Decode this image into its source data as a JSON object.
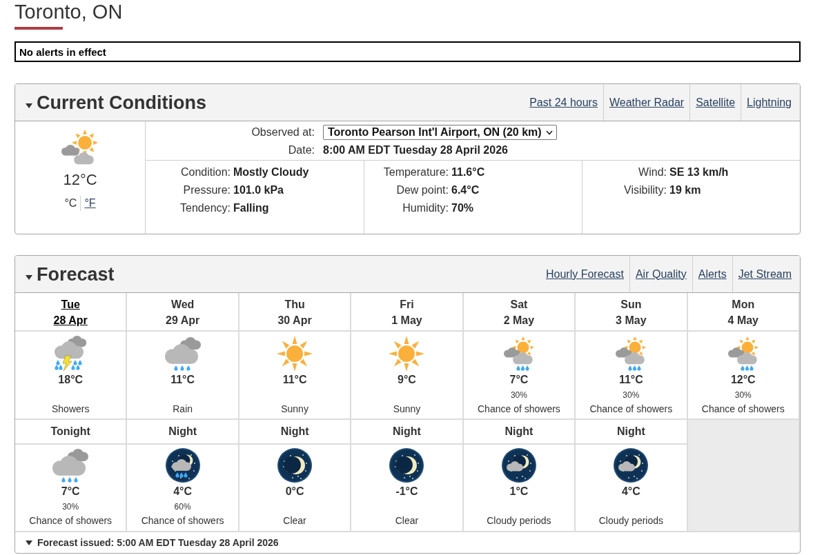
{
  "location": {
    "title": "Toronto, ON"
  },
  "alert_banner": "No alerts in effect",
  "current_conditions": {
    "title": "Current Conditions",
    "expanded": true,
    "links": [
      "Past 24 hours",
      "Weather Radar",
      "Satellite",
      "Lightning"
    ],
    "kind": "suncloud",
    "temperature": "12°C",
    "units": [
      {
        "label": "°C",
        "selected": true
      },
      {
        "label": "°F",
        "selected": false
      }
    ],
    "observed_at": {
      "label": "Observed at:",
      "value": "Toronto Pearson Int'l Airport, ON (20 km)"
    },
    "date": {
      "label": "Date:",
      "value": "8:00 AM EDT Tuesday 28 April 2026"
    },
    "columns": [
      [
        {
          "label": "Condition:",
          "value": "Mostly Cloudy"
        },
        {
          "label": "Pressure:",
          "value": "101.0 kPa"
        },
        {
          "label": "Tendency:",
          "value": "Falling"
        }
      ],
      [
        {
          "label": "Temperature:",
          "value": "11.6°C"
        },
        {
          "label": "Dew point:",
          "value": "6.4°C"
        },
        {
          "label": "Humidity:",
          "value": "70%"
        }
      ],
      [
        {
          "label": "Wind:",
          "value": "SE 13 km/h"
        },
        {
          "label": "Visibility:",
          "value": "19 km"
        }
      ]
    ]
  },
  "forecast": {
    "title": "Forecast",
    "expanded": true,
    "links": [
      "Hourly Forecast",
      "Air Quality",
      "Alerts",
      "Jet Stream"
    ],
    "days": [
      {
        "name": "Tue",
        "date": "28 Apr",
        "selected": true,
        "day": {
          "kind": "thunder",
          "temperature": "18°C",
          "condition": "Showers"
        },
        "night": {
          "name": "Tonight",
          "kind": "rain",
          "temperature": "7°C",
          "pop": "30%",
          "condition": "Chance of showers"
        }
      },
      {
        "name": "Wed",
        "date": "29 Apr",
        "selected": false,
        "day": {
          "kind": "rain",
          "temperature": "11°C",
          "condition": "Rain"
        },
        "night": {
          "name": "Night",
          "kind": "nightrain",
          "temperature": "4°C",
          "pop": "60%",
          "condition": "Chance of showers"
        }
      },
      {
        "name": "Thu",
        "date": "30 Apr",
        "selected": false,
        "day": {
          "kind": "sunny",
          "temperature": "11°C",
          "condition": "Sunny"
        },
        "night": {
          "name": "Night",
          "kind": "nightclear",
          "temperature": "0°C",
          "condition": "Clear"
        }
      },
      {
        "name": "Fri",
        "date": "1 May",
        "selected": false,
        "day": {
          "kind": "sunny",
          "temperature": "9°C",
          "condition": "Sunny"
        },
        "night": {
          "name": "Night",
          "kind": "nightclear",
          "temperature": "-1°C",
          "condition": "Clear"
        }
      },
      {
        "name": "Sat",
        "date": "2 May",
        "selected": false,
        "day": {
          "kind": "sunshowers",
          "temperature": "7°C",
          "pop": "30%",
          "condition": "Chance of showers"
        },
        "night": {
          "name": "Night",
          "kind": "nightcloudy",
          "temperature": "1°C",
          "condition": "Cloudy periods"
        }
      },
      {
        "name": "Sun",
        "date": "3 May",
        "selected": false,
        "day": {
          "kind": "sunshowers",
          "temperature": "11°C",
          "pop": "30%",
          "condition": "Chance of showers"
        },
        "night": {
          "name": "Night",
          "kind": "nightcloudy",
          "temperature": "4°C",
          "condition": "Cloudy periods"
        }
      },
      {
        "name": "Mon",
        "date": "4 May",
        "selected": false,
        "day": {
          "kind": "sunshowers",
          "temperature": "12°C",
          "pop": "30%",
          "condition": "Chance of showers"
        }
      }
    ],
    "issued": {
      "text": "Forecast issued: 5:00 AM EDT Tuesday 28 April 2026",
      "expanded": true
    }
  }
}
